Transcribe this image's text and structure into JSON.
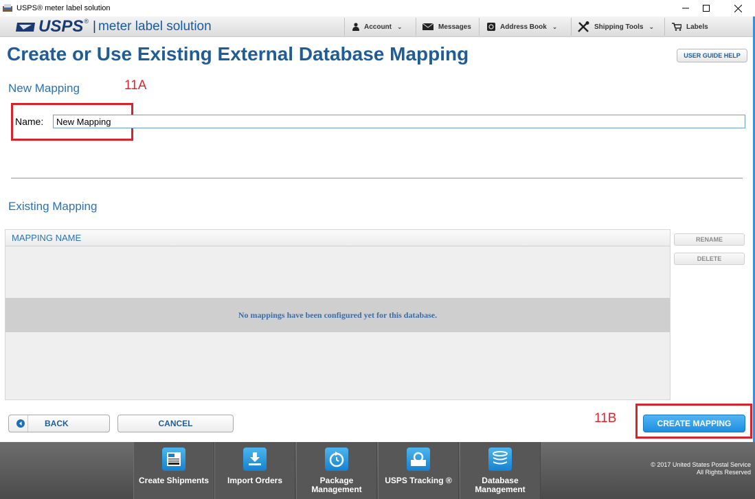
{
  "window": {
    "title": "USPS® meter label solution",
    "controls": [
      "minimize",
      "maximize",
      "close"
    ]
  },
  "header": {
    "logo_text": "USPS",
    "logo_reg": "®",
    "logo_sep": "|",
    "logo_subtitle": "meter label solution",
    "nav": [
      {
        "label": "Account",
        "icon": "person-icon",
        "dropdown": true
      },
      {
        "label": "Messages",
        "icon": "envelope-icon",
        "dropdown": false
      },
      {
        "label": "Address Book",
        "icon": "address-book-icon",
        "dropdown": true
      },
      {
        "label": "Shipping Tools",
        "icon": "tools-icon",
        "dropdown": true
      },
      {
        "label": "Labels",
        "icon": "cart-icon",
        "dropdown": false
      }
    ]
  },
  "page": {
    "title": "Create or Use Existing External Database Mapping",
    "help_button": "USER GUIDE HELP"
  },
  "new_mapping": {
    "section_title": "New Mapping",
    "annotation": "11A",
    "name_label": "Name:",
    "name_value": "New Mapping"
  },
  "existing_mapping": {
    "section_title": "Existing Mapping",
    "column_header": "MAPPING NAME",
    "empty_message": "No mappings have been configured yet for this database.",
    "rename_button": "RENAME",
    "delete_button": "DELETE"
  },
  "actions": {
    "back": "BACK",
    "cancel": "CANCEL",
    "create": "CREATE MAPPING",
    "annotation": "11B"
  },
  "footer": {
    "items": [
      {
        "label": "Create Shipments",
        "icon": "create-shipments-icon"
      },
      {
        "label": "Import Orders",
        "icon": "import-orders-icon"
      },
      {
        "label": "Package\nManagement",
        "icon": "package-management-icon"
      },
      {
        "label": "USPS Tracking ®",
        "icon": "tracking-icon"
      },
      {
        "label": "Database\nManagement",
        "icon": "database-icon"
      }
    ],
    "copyright": "© 2017 United States Postal Service\nAll Rights Reserved"
  },
  "colors": {
    "brand_blue": "#1f5d99",
    "accent_blue": "#2a72b5",
    "annotation_red": "#e0232b",
    "create_button": "#2a9be8"
  }
}
